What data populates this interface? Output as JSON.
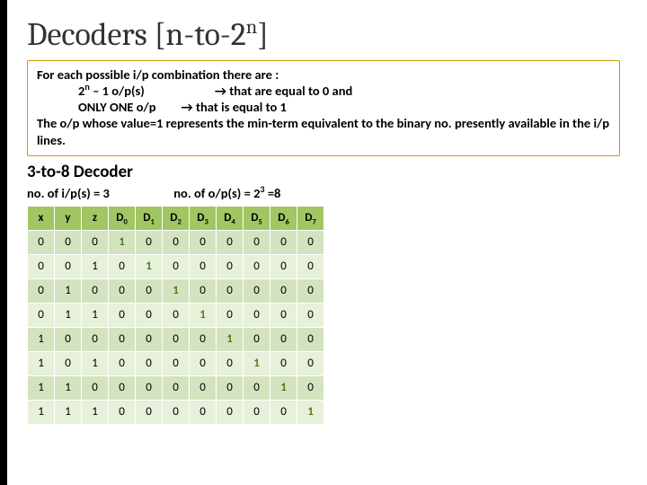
{
  "title": {
    "pre": "Decoders  [n-to-2",
    "sup": "n",
    "post": "]"
  },
  "info": {
    "line1": "For each possible i/p combination there are :",
    "line2_a": "2",
    "line2_sup": "n",
    "line2_b": " – 1 o/p(s)",
    "line2_c": "→ that are equal to 0 and",
    "line3_a": "ONLY ONE o/p",
    "line3_b": "→ that is equal to 1",
    "line4": "The o/p whose value=1 represents the min-term equivalent to the binary no. presently available in the i/p lines."
  },
  "subhead": "3-to-8 Decoder",
  "iprow": {
    "ip": "no. of i/p(s) = 3",
    "op_a": "no. of o/p(s) = 2",
    "op_sup": "3",
    "op_b": " =8"
  },
  "headers_in": [
    "x",
    "y",
    "z"
  ],
  "headers_out": [
    "D",
    "D",
    "D",
    "D",
    "D",
    "D",
    "D",
    "D"
  ],
  "headers_out_sub": [
    "0",
    "1",
    "2",
    "3",
    "4",
    "5",
    "6",
    "7"
  ],
  "rows": [
    {
      "in": [
        "0",
        "0",
        "0"
      ],
      "out": [
        "1",
        "0",
        "0",
        "0",
        "0",
        "0",
        "0",
        "0"
      ]
    },
    {
      "in": [
        "0",
        "0",
        "1"
      ],
      "out": [
        "0",
        "1",
        "0",
        "0",
        "0",
        "0",
        "0",
        "0"
      ]
    },
    {
      "in": [
        "0",
        "1",
        "0"
      ],
      "out": [
        "0",
        "0",
        "1",
        "0",
        "0",
        "0",
        "0",
        "0"
      ]
    },
    {
      "in": [
        "0",
        "1",
        "1"
      ],
      "out": [
        "0",
        "0",
        "0",
        "1",
        "0",
        "0",
        "0",
        "0"
      ]
    },
    {
      "in": [
        "1",
        "0",
        "0"
      ],
      "out": [
        "0",
        "0",
        "0",
        "0",
        "1",
        "0",
        "0",
        "0"
      ]
    },
    {
      "in": [
        "1",
        "0",
        "1"
      ],
      "out": [
        "0",
        "0",
        "0",
        "0",
        "0",
        "1",
        "0",
        "0"
      ]
    },
    {
      "in": [
        "1",
        "1",
        "0"
      ],
      "out": [
        "0",
        "0",
        "0",
        "0",
        "0",
        "0",
        "1",
        "0"
      ]
    },
    {
      "in": [
        "1",
        "1",
        "1"
      ],
      "out": [
        "0",
        "0",
        "0",
        "0",
        "0",
        "0",
        "0",
        "1"
      ]
    }
  ],
  "chart_data": {
    "type": "table",
    "title": "3-to-8 Decoder truth table",
    "columns": [
      "x",
      "y",
      "z",
      "D0",
      "D1",
      "D2",
      "D3",
      "D4",
      "D5",
      "D6",
      "D7"
    ],
    "rows": [
      [
        0,
        0,
        0,
        1,
        0,
        0,
        0,
        0,
        0,
        0,
        0
      ],
      [
        0,
        0,
        1,
        0,
        1,
        0,
        0,
        0,
        0,
        0,
        0
      ],
      [
        0,
        1,
        0,
        0,
        0,
        1,
        0,
        0,
        0,
        0,
        0
      ],
      [
        0,
        1,
        1,
        0,
        0,
        0,
        1,
        0,
        0,
        0,
        0
      ],
      [
        1,
        0,
        0,
        0,
        0,
        0,
        0,
        1,
        0,
        0,
        0
      ],
      [
        1,
        0,
        1,
        0,
        0,
        0,
        0,
        0,
        1,
        0,
        0
      ],
      [
        1,
        1,
        0,
        0,
        0,
        0,
        0,
        0,
        0,
        1,
        0
      ],
      [
        1,
        1,
        1,
        0,
        0,
        0,
        0,
        0,
        0,
        0,
        1
      ]
    ]
  }
}
